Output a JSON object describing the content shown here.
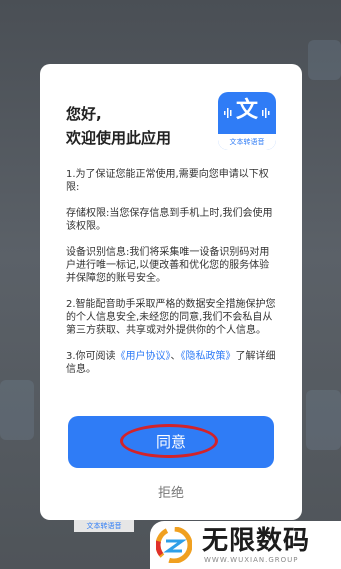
{
  "dialog": {
    "greeting_line1": "您好,",
    "greeting_line2": "欢迎使用此应用",
    "app_icon_glyph": "文",
    "app_icon_caption": "文本转语音",
    "policy": {
      "item1": "1.为了保证您能正常使用,需要向您申请以下权限:",
      "storage": "存储权限:当您保存信息到手机上时,我们会使用该权限。",
      "device_id": "设备识别信息:我们将采集唯一设备识别码对用户进行唯一标记,以便改善和优化您的服务体验并保障您的账号安全。",
      "item2": "2.智能配音助手采取严格的数据安全措施保护您的个人信息安全,未经您的同意,我们不会私自从第三方获取、共享或对外提供你的个人信息。",
      "item3_prefix": "3.你可阅读",
      "user_agreement_link": "《用户协议》",
      "item3_separator": "、",
      "privacy_link": "《隐私政策》",
      "item3_suffix": "了解详细信息。"
    },
    "agree_label": "同意",
    "refuse_label": "拒绝"
  },
  "background": {
    "behind_caption": "文本转语音"
  },
  "watermark": {
    "title": "无限数码",
    "subtitle": "WWW.WUXIAN.GROUP"
  },
  "colors": {
    "accent": "#2f7cf6",
    "highlight_ring": "#d2232a",
    "overlay": "#555a60"
  }
}
